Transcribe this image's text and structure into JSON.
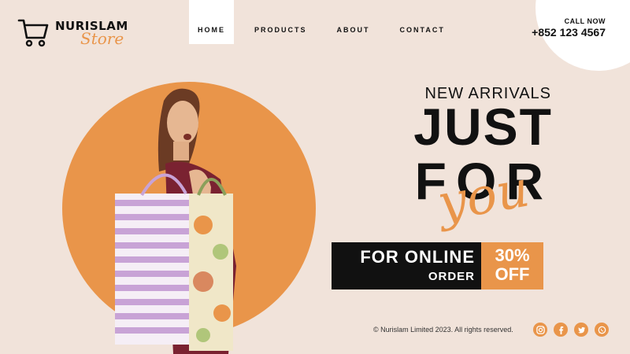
{
  "brand": {
    "name": "NURISLAM",
    "sub": "Store"
  },
  "nav": {
    "items": [
      {
        "label": "HOME"
      },
      {
        "label": "PRODUCTS"
      },
      {
        "label": "ABOUT"
      },
      {
        "label": "CONTACT"
      }
    ]
  },
  "contact": {
    "label": "CALL NOW",
    "phone": "+852 123 4567"
  },
  "hero": {
    "eyebrow": "NEW ARRIVALS",
    "line1": "JUST",
    "line2": "FOR",
    "script": "you"
  },
  "promo": {
    "line1": "FOR ONLINE",
    "line2": "ORDER",
    "percent": "30%",
    "off": "OFF"
  },
  "footer": {
    "copyright": "© Nurislam Limited 2023. All rights reserved.",
    "social": [
      {
        "icon": "instagram-icon"
      },
      {
        "icon": "facebook-icon"
      },
      {
        "icon": "twitter-icon"
      },
      {
        "icon": "whatsapp-icon"
      }
    ]
  },
  "colors": {
    "background": "#f1e3da",
    "accent": "#e9954a",
    "dark": "#111111"
  }
}
